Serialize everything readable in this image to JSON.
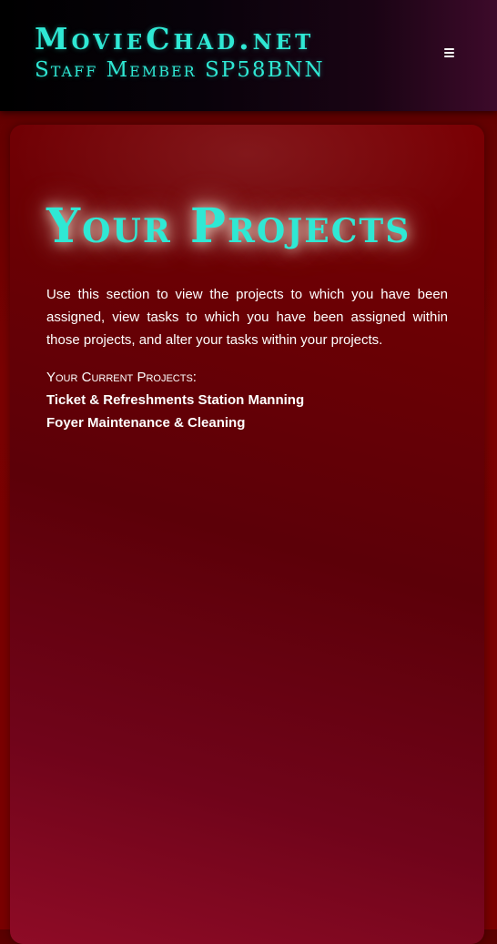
{
  "header": {
    "site_name": "MovieChad.net",
    "staff_label": "Staff Member SP58BNN",
    "menu_icon": "hamburger-menu-icon"
  },
  "main": {
    "title": "Your Projects",
    "intro": "Use this section to view the projects to which you have been assigned, view tasks to which you have been assigned within those projects, and alter your tasks within your projects.",
    "projects_heading": "Your Current Projects:",
    "projects": [
      {
        "name": "Ticket & Refreshments Station Manning"
      },
      {
        "name": "Foyer Maintenance & Cleaning"
      }
    ]
  },
  "colors": {
    "accent": "#2fe8d4",
    "header_bg": "#000000",
    "page_bg": "#7a0000",
    "card_bg": "#5c0008"
  }
}
